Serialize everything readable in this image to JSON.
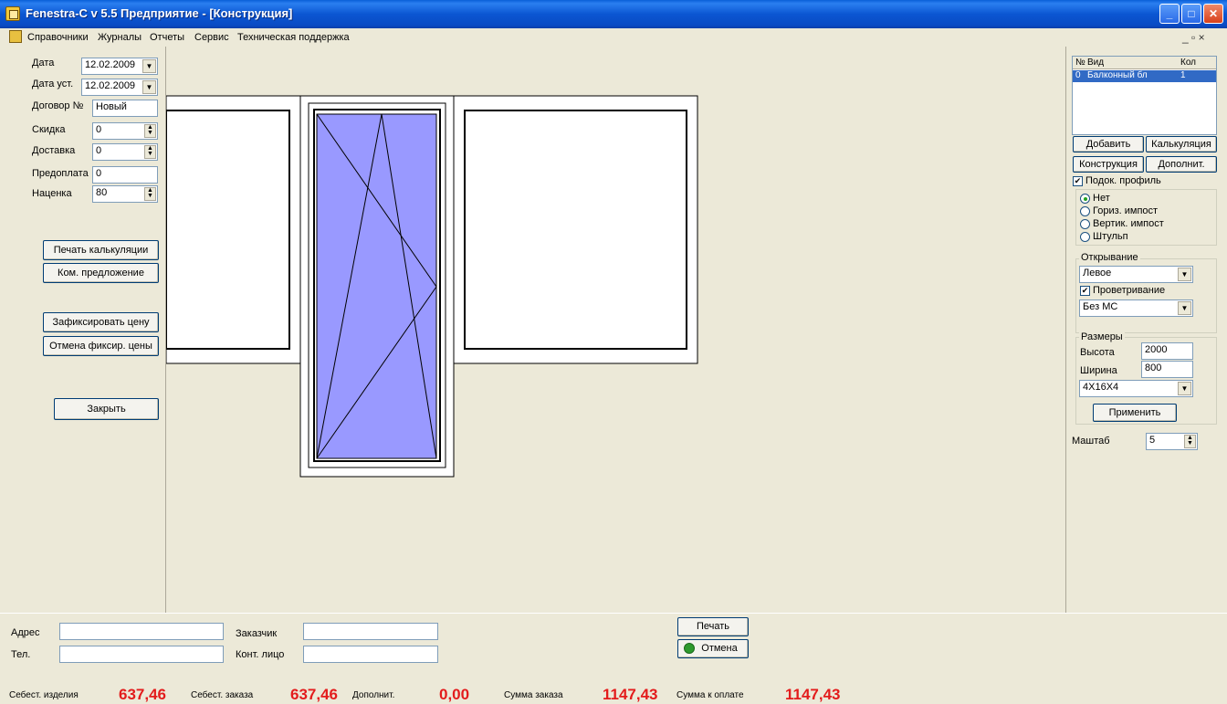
{
  "window": {
    "title": "Fenestra-C v 5.5 Предприятие - [Конструкция]",
    "minimize": "_",
    "maximize": "□",
    "close": "✕"
  },
  "menu": {
    "items": [
      "Справочники",
      "Журналы",
      "Отчеты",
      "Сервис",
      "Техническая поддержка"
    ],
    "mdi_controls": "_ ▫ ×"
  },
  "left": {
    "date_label": "Дата",
    "date_value": "12.02.2009",
    "install_date_label": "Дата уст.",
    "install_date_value": "12.02.2009",
    "contract_label": "Договор №",
    "contract_value": "Новый",
    "discount_label": "Скидка",
    "discount_value": "0",
    "delivery_label": "Доставка",
    "delivery_value": "0",
    "prepay_label": "Предоплата",
    "prepay_value": "0",
    "markup_label": "Наценка",
    "markup_value": "80",
    "print_calc": "Печать калькуляции",
    "com_offer": "Ком. предложение",
    "fix_price": "Зафиксировать цену",
    "cancel_fix": "Отмена фиксир. цены",
    "close": "Закрыть"
  },
  "right": {
    "list_headers": [
      "№",
      "Вид",
      "Кол"
    ],
    "list_rows": [
      {
        "num": "0",
        "kind": "Балконный бл",
        "qty": "1"
      }
    ],
    "add": "Добавить",
    "calc": "Калькуляция",
    "construct": "Конструкция",
    "extra": "Дополнит.",
    "sill_profile": "Подок. профиль",
    "radio_none": "Нет",
    "radio_horiz": "Гориз. импост",
    "radio_vert": "Вертик. импост",
    "radio_shtulp": "Штульп",
    "opening_label": "Открывание",
    "opening_value": "Левое",
    "ventilation": "Проветривание",
    "ms_value": "Без МС",
    "sizes_label": "Размеры",
    "height_label": "Высота",
    "height_value": "2000",
    "width_label": "Ширина",
    "width_value": "800",
    "glass_value": "4Х16Х4",
    "apply": "Применить",
    "scale_label": "Маштаб",
    "scale_value": "5"
  },
  "bottom": {
    "address_label": "Адрес",
    "address_value": "",
    "phone_label": "Тел.",
    "phone_value": "",
    "customer_label": "Заказчик",
    "customer_value": "",
    "contact_label": "Конт. лицо",
    "contact_value": "",
    "print": "Печать",
    "cancel": "Отмена",
    "cost_item_label": "Себест. изделия",
    "cost_item_value": "637,46",
    "cost_order_label": "Себест. заказа",
    "cost_order_value": "637,46",
    "extra_label": "Дополнит.",
    "extra_value": "0,00",
    "order_sum_label": "Сумма заказа",
    "order_sum_value": "1147,43",
    "to_pay_label": "Сумма к оплате",
    "to_pay_value": "1147,43"
  },
  "colors": {
    "glass": "#9999ff",
    "totals": "#e31c1c",
    "selection": "#316ac5"
  }
}
